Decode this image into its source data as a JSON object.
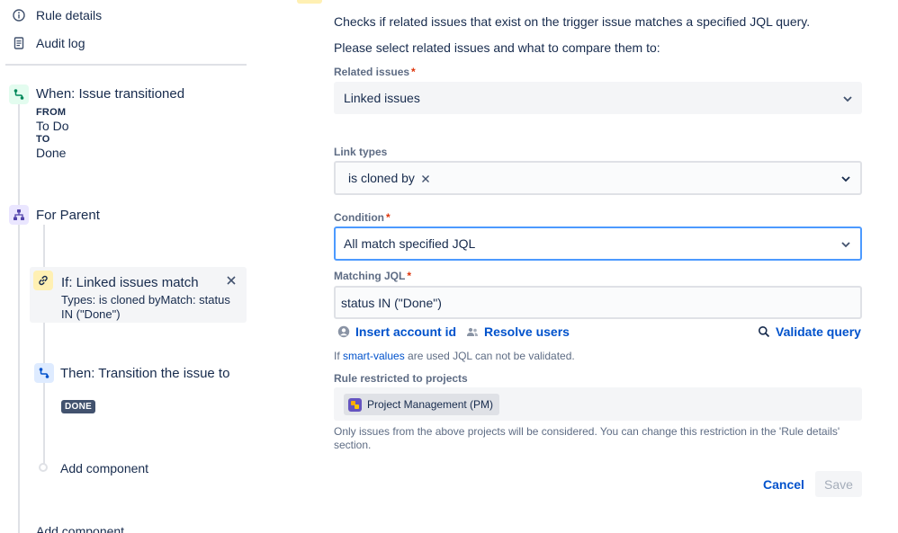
{
  "nav": {
    "rule_details": "Rule details",
    "audit_log": "Audit log"
  },
  "trigger": {
    "title": "When: Issue transitioned",
    "from_label": "FROM",
    "from_value": "To Do",
    "to_label": "TO",
    "to_value": "Done"
  },
  "branch": {
    "title": "For Parent"
  },
  "condition_card": {
    "title": "If: Linked issues match",
    "description": "Types: is cloned byMatch: status IN (\"Done\")"
  },
  "action": {
    "title": "Then: Transition the issue to",
    "status_lozenge": "DONE"
  },
  "add_component_inner": "Add component",
  "add_component_outer": "Add component",
  "form": {
    "intro": "Checks if related issues that exist on the trigger issue matches a specified JQL query.",
    "prompt": "Please select related issues and what to compare them to:",
    "related_issues_label": "Related issues",
    "related_issues_value": "Linked issues",
    "link_types_label": "Link types",
    "link_type_tag": "is cloned by",
    "condition_label": "Condition",
    "condition_value": "All match specified JQL",
    "matching_jql_label": "Matching JQL",
    "matching_jql_value": "status IN (\"Done\")",
    "insert_account_id": "Insert account id",
    "resolve_users": "Resolve users",
    "validate_query": "Validate query",
    "hint_prefix": "If ",
    "hint_link": "smart-values",
    "hint_suffix": " are used JQL can not be validated.",
    "restricted_label": "Rule restricted to projects",
    "project_chip": "Project Management (PM)",
    "restriction_note": "Only issues from the above projects will be considered. You can change this restriction in the 'Rule details' section.",
    "cancel": "Cancel",
    "save": "Save"
  },
  "colors": {
    "link": "#0052cc",
    "required": "#de350b",
    "focus_border": "#4c9aff",
    "trigger_icon_bg": "#e3fcef",
    "branch_icon_bg": "#eae6ff",
    "condition_icon_bg": "#fff0b3",
    "action_icon_bg": "#deebff"
  }
}
